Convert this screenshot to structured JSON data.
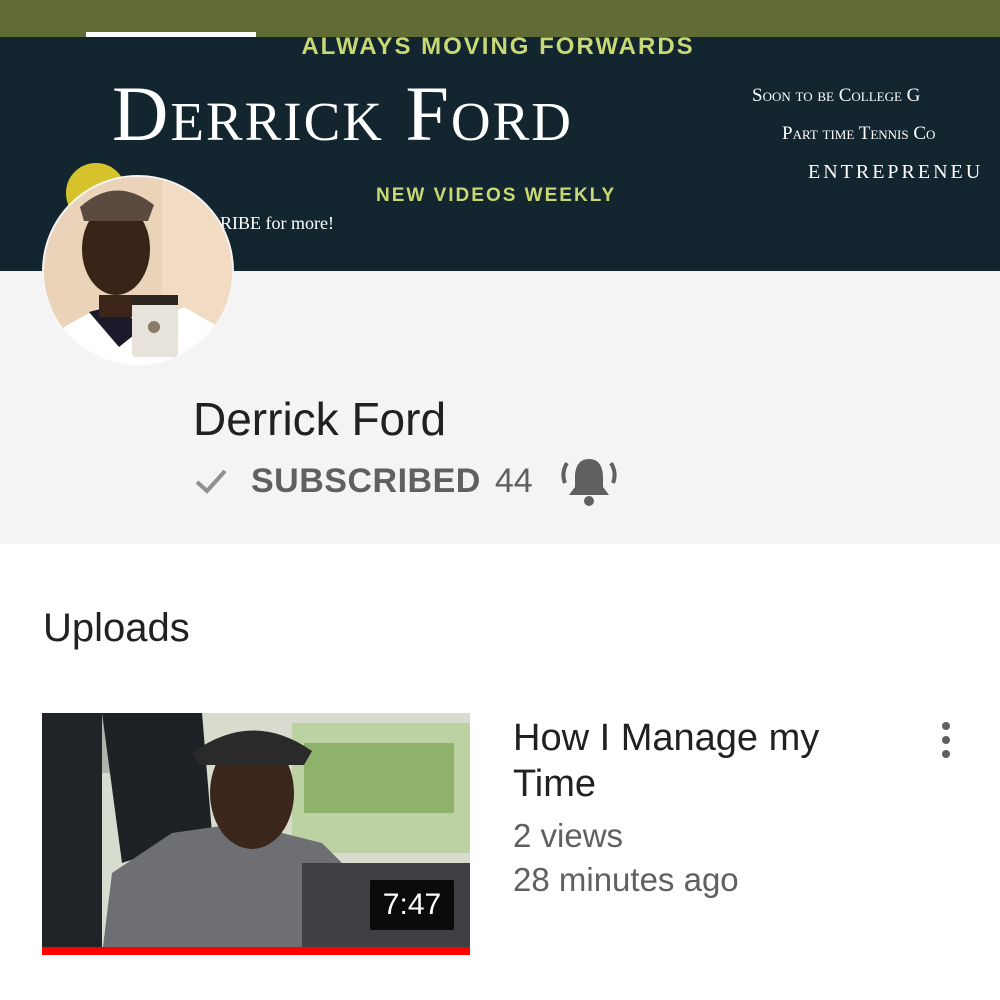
{
  "banner": {
    "tagline": "ALWAYS MOVING FORWARDS",
    "name": "Derrick Ford",
    "weekly": "NEW VIDEOS WEEKLY",
    "subscribe_more": "RIBE for more!",
    "right_lines": [
      "Soon to be College G",
      "Part time Tennis Co",
      "ENTREPRENEU"
    ]
  },
  "channel": {
    "name": "Derrick Ford",
    "subscribed_label": "SUBSCRIBED",
    "subscriber_count": "44"
  },
  "uploads": {
    "label": "Uploads",
    "videos": [
      {
        "title": "How I Manage my Time",
        "views": "2 views",
        "age": "28 minutes ago",
        "duration": "7:47",
        "watched_fraction": 1.0
      }
    ]
  },
  "colors": {
    "top_bar": "#616b36",
    "banner_bg": "#13262f",
    "banner_accent": "#c8d872",
    "progress": "#ff0000"
  },
  "icons": [
    "check-icon",
    "bell-icon",
    "more-vert-icon"
  ]
}
